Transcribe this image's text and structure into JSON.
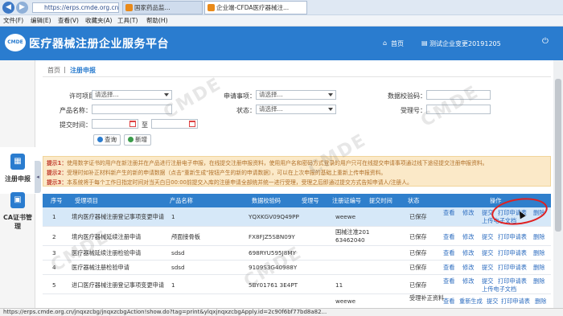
{
  "browser": {
    "url": "https://erps.cmde.org.cn/index",
    "tabs": [
      {
        "label": "国家药品监..."
      },
      {
        "label": "企业端-CFDA医疗器械注..."
      }
    ],
    "menu": [
      "文件(F)",
      "编辑(E)",
      "查看(V)",
      "收藏夹(A)",
      "工具(T)",
      "帮助(H)"
    ],
    "status_url": "https://erps.cmde.org.cn/jnqxzcbg/jnqxzcbgAction!show.do?tag=print&ylqxjnqxzcbgApply.id=2c90f6bf77bd8a82..."
  },
  "header": {
    "logo_text": "CMDE",
    "title": "医疗器械注册企业服务平台",
    "home_label": "首页",
    "user_label": "测试企业变更20191205",
    "home_icon": "home-icon",
    "user_icon": "user-icon"
  },
  "sidebar": {
    "items": [
      {
        "label": "注册申报",
        "icon": "register-icon"
      },
      {
        "label": "CA证书管理",
        "icon": "certificate-icon"
      }
    ]
  },
  "breadcrumb": {
    "home": "首页",
    "sep": "|",
    "current": "注册申报"
  },
  "filters": {
    "project_label": "许可项目：",
    "project_value": "请选择...",
    "type_label": "申请事项：",
    "type_value": "请选择...",
    "code_label": "数据校验码：",
    "product_label": "产品名称：",
    "status_label": "状态：",
    "status_value": "请选择...",
    "accept_label": "受理号：",
    "date_label": "提交时间：",
    "date_sep": "至",
    "search_btn": "查询",
    "add_btn": "新增"
  },
  "notice": [
    {
      "tag": "提示1：",
      "text": "使用数字证书的用户在新注册并在产品进行注册电子申报，在线提交注册申报资料，使用用户名和密码方式登录的用户只可在线提交申请事项通过线下途径提交注册申报资料。"
    },
    {
      "tag": "提示2：",
      "text": "受理时如补正材料新产生的新的申请数据（点击\"重新生成\"按钮产生的新的申请数据），可以在上次申报的基础上重新上传申报资料。"
    },
    {
      "tag": "提示3：",
      "text": "本系统将于每个工作日指定时间对当天白日00:00前提交入库的注册申请全部统并统一进行受理，受理之后即通过提交方式告知申请人/注册人。"
    }
  ],
  "table": {
    "columns": [
      "序号",
      "受理项目",
      "产品名称",
      "数据校验码",
      "受理号",
      "注册证编号",
      "提交时间",
      "状态",
      "操作"
    ],
    "rows": [
      {
        "no": "1",
        "item": "境内医疗器械注册登记事项变更申请",
        "product": "1",
        "code": "YQXKGV09Q49PP",
        "accept": "",
        "reg": "weewe",
        "time": "",
        "status": "已保存",
        "actions": [
          "查看",
          "修改",
          "提交",
          "打印申请表",
          "删除"
        ],
        "actions2": [
          "上传电子文档"
        ]
      },
      {
        "no": "2",
        "item": "境内医疗器械延续注册申请",
        "product": "颅面接骨板",
        "code": "FX8FJZ5SBN09Y",
        "accept": "",
        "reg": "国械注准201 63462040",
        "time": "",
        "status": "已保存",
        "actions": [
          "查看",
          "修改",
          "提交",
          "打印申请表",
          "删除"
        ],
        "actions2": []
      },
      {
        "no": "3",
        "item": "医疗器械延续注册检验申请",
        "product": "sdsd",
        "code": "698RYU595J8MY",
        "accept": "",
        "reg": "",
        "time": "",
        "status": "已保存",
        "actions": [
          "查看",
          "修改",
          "提交",
          "打印申请表",
          "删除"
        ],
        "actions2": []
      },
      {
        "no": "4",
        "item": "医疗器械注册检验申请",
        "product": "sdsd",
        "code": "9109S3G40988Y",
        "accept": "",
        "reg": "",
        "time": "",
        "status": "已保存",
        "actions": [
          "查看",
          "修改",
          "提交",
          "打印申请表",
          "删除"
        ],
        "actions2": []
      },
      {
        "no": "5",
        "item": "进口医疗器械注册登记事项变更申请",
        "product": "1",
        "code": "5BY01761 3E4PT",
        "accept": "",
        "reg": "11",
        "time": "",
        "status": "已保存",
        "actions": [
          "查看",
          "修改",
          "提交",
          "打印申请表",
          "删除"
        ],
        "actions2": [
          "上传电子文档"
        ]
      },
      {
        "no": "",
        "item": "",
        "product": "",
        "code": "",
        "accept": "",
        "reg": "weewe",
        "time": "",
        "status": "受理补正资料",
        "actions": [
          "查看",
          "重新生成",
          "提交",
          "打印申请表",
          "删除"
        ],
        "actions2": []
      }
    ]
  },
  "watermark": "CMDE",
  "colors": {
    "header": "#2a7ccf",
    "table_header": "#2f7fcc",
    "notice_bg": "#fbe9c8",
    "highlight_circle": "#e02020"
  }
}
